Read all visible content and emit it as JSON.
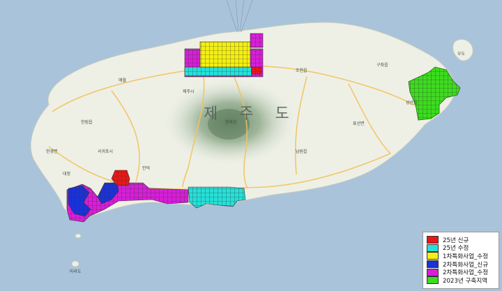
{
  "map": {
    "island_title": "제 주 도",
    "place_labels": [
      {
        "name": "제주시",
        "kind": "city"
      },
      {
        "name": "서귀포시",
        "kind": "city"
      },
      {
        "name": "우도",
        "kind": "island"
      },
      {
        "name": "한라산",
        "kind": "mountain"
      },
      {
        "name": "애월",
        "kind": "town"
      },
      {
        "name": "한림읍",
        "kind": "town"
      },
      {
        "name": "한경면",
        "kind": "town"
      },
      {
        "name": "대정",
        "kind": "town"
      },
      {
        "name": "안덕",
        "kind": "town"
      },
      {
        "name": "남원읍",
        "kind": "town"
      },
      {
        "name": "표선면",
        "kind": "town"
      },
      {
        "name": "성산읍",
        "kind": "town"
      },
      {
        "name": "구좌읍",
        "kind": "town"
      },
      {
        "name": "조천읍",
        "kind": "town"
      },
      {
        "name": "마라도",
        "kind": "island"
      }
    ]
  },
  "legend": {
    "items": [
      {
        "label": "25년 신규",
        "color": "#e81818"
      },
      {
        "label": "25년 수정",
        "color": "#26e0d8"
      },
      {
        "label": "1차특화사업_수정",
        "color": "#f4f010"
      },
      {
        "label": "2차특화사업_신규",
        "color": "#1a32d8"
      },
      {
        "label": "2차특화사업_수정",
        "color": "#d81ed8"
      },
      {
        "label": "2023년 구축지역",
        "color": "#3ddc1e"
      }
    ]
  }
}
